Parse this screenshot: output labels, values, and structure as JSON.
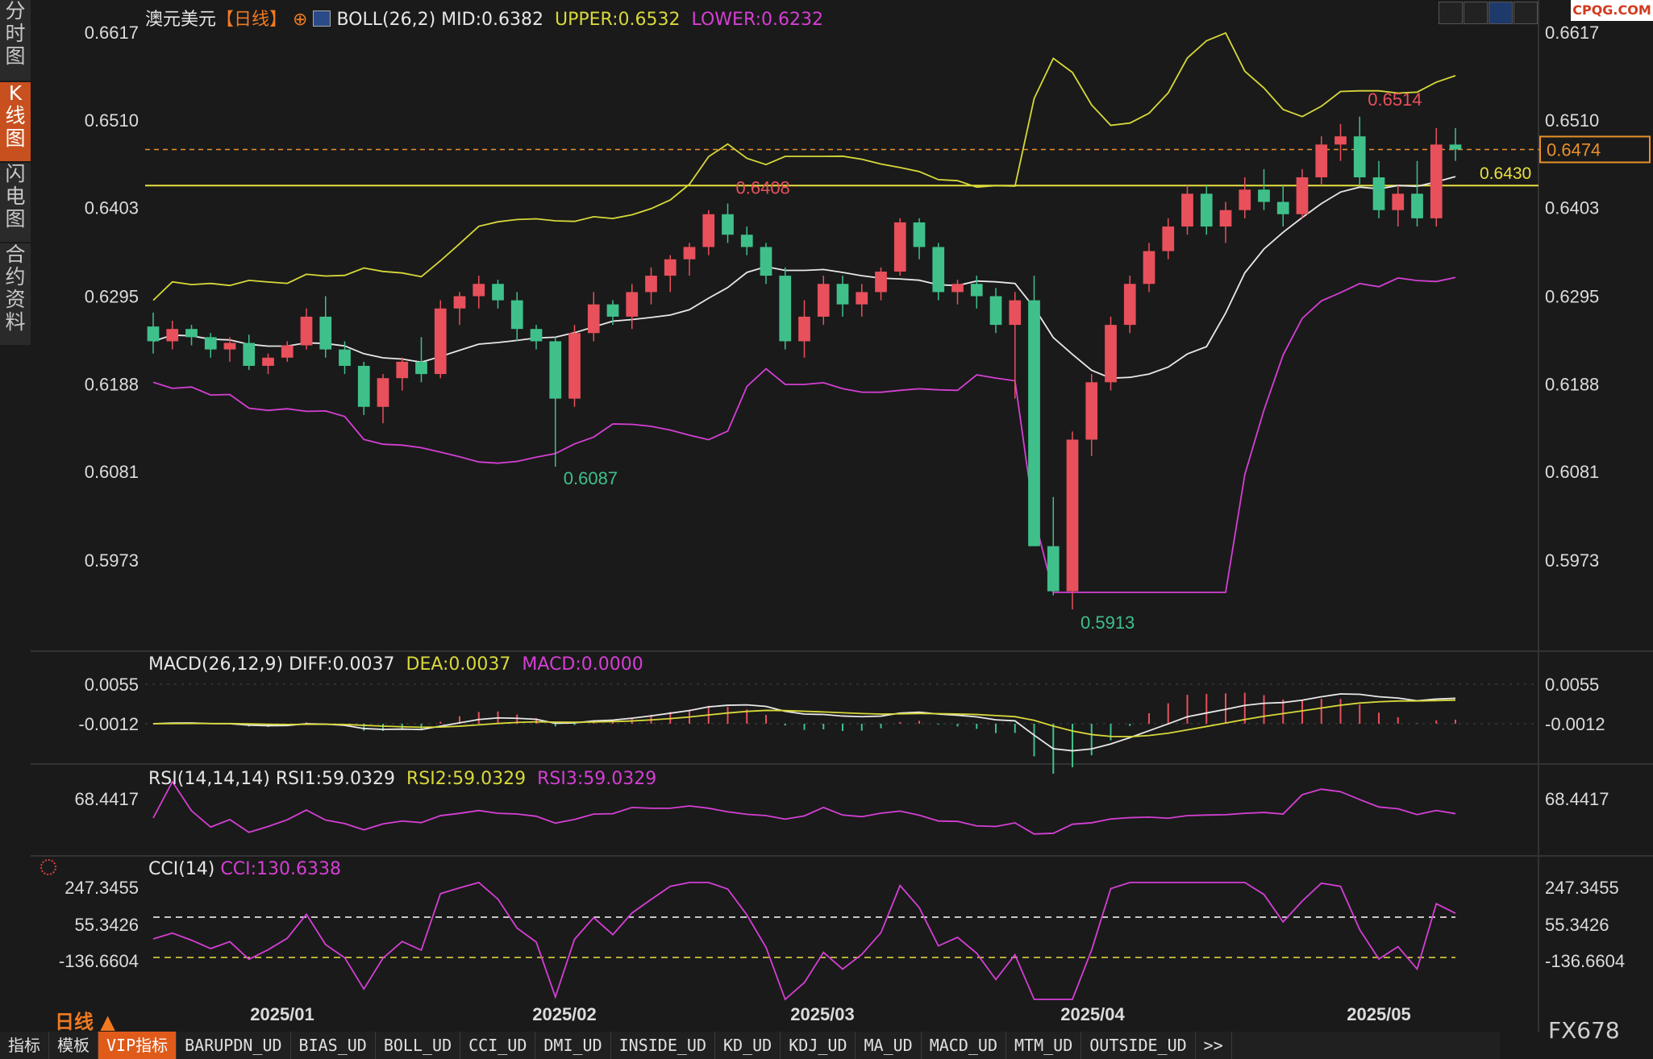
{
  "side_tabs": [
    {
      "label": "分时图"
    },
    {
      "label": "K线图"
    },
    {
      "label": "闪电图"
    },
    {
      "label": "合约资料"
    }
  ],
  "header": {
    "symbol": "澳元美元",
    "period": "【日线】",
    "boll": "BOLL(26,2)",
    "mid": "MID:0.6382",
    "upper": "UPPER:0.6532",
    "lower": "LOWER:0.6232",
    "brand": "CPQG.COM"
  },
  "axis": {
    "price_ticks": [
      "0.6617",
      "0.6510",
      "0.6403",
      "0.6295",
      "0.6188",
      "0.6081",
      "0.5973"
    ],
    "macd_ticks": [
      "0.0055",
      "-0.0012"
    ],
    "rsi_ticks": [
      "68.4417"
    ],
    "cci_ticks": [
      "247.3455",
      "55.3426",
      "-136.6604"
    ],
    "dates": [
      "2025/01",
      "2025/02",
      "2025/03",
      "2025/04",
      "2025/05"
    ]
  },
  "annotations": {
    "high": "0.6514",
    "low": "0.5913",
    "high2": "0.6408",
    "low2": "0.6087",
    "level_line": "0.6430",
    "last_price": "0.6474"
  },
  "indicators": {
    "macd": {
      "label": "MACD(26,12,9)",
      "diff": "DIFF:0.0037",
      "dea": "DEA:0.0037",
      "macd": "MACD:0.0000"
    },
    "rsi": {
      "label": "RSI(14,14,14)",
      "rsi1": "RSI1:59.0329",
      "rsi2": "RSI2:59.0329",
      "rsi3": "RSI3:59.0329"
    },
    "cci": {
      "label": "CCI(14)",
      "cci": "CCI:130.6338"
    }
  },
  "footer": {
    "period_label": "日线 ▲",
    "ticker": "FX678"
  },
  "bottom_tabs": [
    "指标",
    "模板",
    "VIP指标",
    "BARUPDN_UD",
    "BIAS_UD",
    "BOLL_UD",
    "CCI_UD",
    "DMI_UD",
    "INSIDE_UD",
    "KD_UD",
    "KDJ_UD",
    "MA_UD",
    "MACD_UD",
    "MTM_UD",
    "OUTSIDE_UD",
    ">>"
  ],
  "colors": {
    "up": "#e8505b",
    "down": "#3fc08a",
    "upper": "#d8d83a",
    "mid": "#e8e8e8",
    "lower": "#d43fd4",
    "rsi": "#d43fd4"
  },
  "chart_data": {
    "type": "candlestick",
    "title": "澳元美元 日线",
    "dates": [
      "2025/01",
      "2025/02",
      "2025/03",
      "2025/04",
      "2025/05"
    ],
    "ylim": [
      0.5973,
      0.6617
    ],
    "candles": [
      [
        0.6258,
        0.6275,
        0.6225,
        0.624
      ],
      [
        0.624,
        0.6265,
        0.623,
        0.6255
      ],
      [
        0.6255,
        0.626,
        0.6235,
        0.6245
      ],
      [
        0.6245,
        0.625,
        0.622,
        0.623
      ],
      [
        0.623,
        0.6245,
        0.6215,
        0.6238
      ],
      [
        0.6238,
        0.6248,
        0.6205,
        0.621
      ],
      [
        0.621,
        0.6225,
        0.62,
        0.622
      ],
      [
        0.622,
        0.624,
        0.6215,
        0.6235
      ],
      [
        0.6235,
        0.628,
        0.623,
        0.627
      ],
      [
        0.627,
        0.6295,
        0.622,
        0.623
      ],
      [
        0.623,
        0.624,
        0.62,
        0.621
      ],
      [
        0.621,
        0.6215,
        0.615,
        0.616
      ],
      [
        0.616,
        0.62,
        0.614,
        0.6195
      ],
      [
        0.6195,
        0.622,
        0.618,
        0.6215
      ],
      [
        0.6215,
        0.6245,
        0.619,
        0.62
      ],
      [
        0.62,
        0.629,
        0.6195,
        0.628
      ],
      [
        0.628,
        0.63,
        0.626,
        0.6295
      ],
      [
        0.6295,
        0.632,
        0.628,
        0.631
      ],
      [
        0.631,
        0.6315,
        0.628,
        0.629
      ],
      [
        0.629,
        0.63,
        0.624,
        0.6255
      ],
      [
        0.6255,
        0.626,
        0.623,
        0.624
      ],
      [
        0.624,
        0.6245,
        0.6087,
        0.617
      ],
      [
        0.617,
        0.626,
        0.616,
        0.625
      ],
      [
        0.625,
        0.63,
        0.624,
        0.6285
      ],
      [
        0.6285,
        0.629,
        0.626,
        0.627
      ],
      [
        0.627,
        0.631,
        0.6255,
        0.63
      ],
      [
        0.63,
        0.633,
        0.6285,
        0.632
      ],
      [
        0.632,
        0.6345,
        0.63,
        0.634
      ],
      [
        0.634,
        0.636,
        0.632,
        0.6355
      ],
      [
        0.6355,
        0.64,
        0.6345,
        0.6395
      ],
      [
        0.6395,
        0.6408,
        0.636,
        0.637
      ],
      [
        0.637,
        0.638,
        0.6345,
        0.6355
      ],
      [
        0.6355,
        0.636,
        0.631,
        0.632
      ],
      [
        0.632,
        0.633,
        0.623,
        0.624
      ],
      [
        0.624,
        0.629,
        0.622,
        0.627
      ],
      [
        0.627,
        0.632,
        0.626,
        0.631
      ],
      [
        0.631,
        0.632,
        0.627,
        0.6285
      ],
      [
        0.6285,
        0.631,
        0.627,
        0.63
      ],
      [
        0.63,
        0.633,
        0.629,
        0.6325
      ],
      [
        0.6325,
        0.639,
        0.632,
        0.6385
      ],
      [
        0.6385,
        0.639,
        0.634,
        0.6355
      ],
      [
        0.6355,
        0.636,
        0.629,
        0.63
      ],
      [
        0.63,
        0.6315,
        0.6285,
        0.631
      ],
      [
        0.631,
        0.632,
        0.628,
        0.6295
      ],
      [
        0.6295,
        0.6305,
        0.625,
        0.626
      ],
      [
        0.626,
        0.63,
        0.617,
        0.629
      ],
      [
        0.629,
        0.632,
        0.61,
        0.599
      ],
      [
        0.599,
        0.605,
        0.593,
        0.5935
      ],
      [
        0.5935,
        0.613,
        0.5913,
        0.612
      ],
      [
        0.612,
        0.62,
        0.61,
        0.619
      ],
      [
        0.619,
        0.627,
        0.618,
        0.626
      ],
      [
        0.626,
        0.632,
        0.625,
        0.631
      ],
      [
        0.631,
        0.636,
        0.63,
        0.635
      ],
      [
        0.635,
        0.639,
        0.634,
        0.638
      ],
      [
        0.638,
        0.643,
        0.637,
        0.642
      ],
      [
        0.642,
        0.643,
        0.637,
        0.638
      ],
      [
        0.638,
        0.641,
        0.636,
        0.64
      ],
      [
        0.64,
        0.644,
        0.639,
        0.6425
      ],
      [
        0.6425,
        0.645,
        0.64,
        0.641
      ],
      [
        0.641,
        0.643,
        0.638,
        0.6395
      ],
      [
        0.6395,
        0.645,
        0.639,
        0.644
      ],
      [
        0.644,
        0.649,
        0.643,
        0.648
      ],
      [
        0.648,
        0.6505,
        0.646,
        0.649
      ],
      [
        0.649,
        0.6514,
        0.643,
        0.644
      ],
      [
        0.644,
        0.646,
        0.639,
        0.64
      ],
      [
        0.64,
        0.643,
        0.638,
        0.642
      ],
      [
        0.642,
        0.646,
        0.638,
        0.639
      ],
      [
        0.639,
        0.65,
        0.638,
        0.648
      ],
      [
        0.648,
        0.65,
        0.646,
        0.6474
      ]
    ]
  }
}
